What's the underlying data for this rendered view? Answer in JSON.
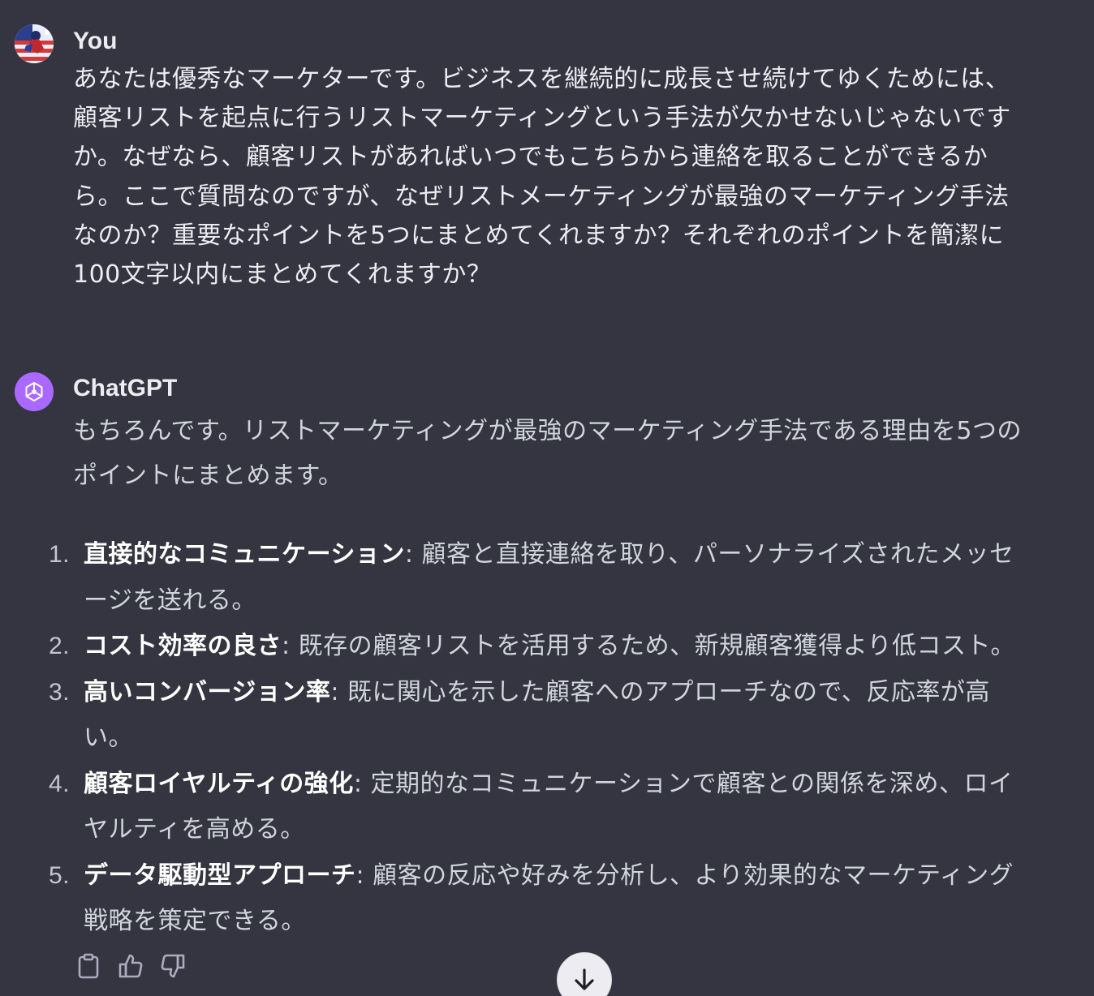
{
  "user": {
    "author": "You",
    "message_lines": [
      "あなたは優秀なマーケターです。ビジネスを継続的に成長させ続けてゆくためには、",
      "顧客リストを起点に行うリストマーケティングという手法が欠かせないじゃないです",
      "か。なぜなら、顧客リストがあればいつでもこちらから連絡を取ることができるか",
      "ら。ここで質問なのですが、なぜリストメーケティングが最強のマーケティング手法",
      "なのか？重要なポイントを5つにまとめてくれますか？それぞれのポイントを簡潔に",
      "100文字以内にまとめてくれますか？"
    ]
  },
  "assistant": {
    "author": "ChatGPT",
    "intro_lines": [
      "もちろんです。リストマーケティングが最強のマーケティング手法である理由を5つの",
      "ポイントにまとめます。"
    ],
    "points": [
      {
        "num": "1.",
        "title": "直接的なコミュニケーション",
        "line1": ": 顧客と直接連絡を取り、パーソナライズされたメッセ",
        "line2": "ージを送れる。"
      },
      {
        "num": "2.",
        "title": "コスト効率の良さ",
        "line1": ": 既存の顧客リストを活用するため、新規顧客獲得より低コスト。",
        "line2": ""
      },
      {
        "num": "3.",
        "title": "高いコンバージョン率",
        "line1": ": 既に関心を示した顧客へのアプローチなので、反応率が高",
        "line2": "い。"
      },
      {
        "num": "4.",
        "title": "顧客ロイヤルティの強化",
        "line1": ": 定期的なコミュニケーションで顧客との関係を深め、ロイ",
        "line2": "ヤルティを高める。"
      },
      {
        "num": "5.",
        "title": "データ駆動型アプローチ",
        "line1": ": 顧客の反応や好みを分析し、より効果的なマーケティング",
        "line2": "戦略を策定できる。"
      }
    ]
  },
  "actions": {
    "icons": [
      "clipboard-icon",
      "thumbs-up-icon",
      "thumbs-down-icon"
    ]
  },
  "scroll": {
    "icon": "arrow-down-icon"
  },
  "colors": {
    "background": "#343541",
    "gpt_avatar": "#ab68ff",
    "text": "#ececf1",
    "answer_text": "#d1d5db"
  }
}
